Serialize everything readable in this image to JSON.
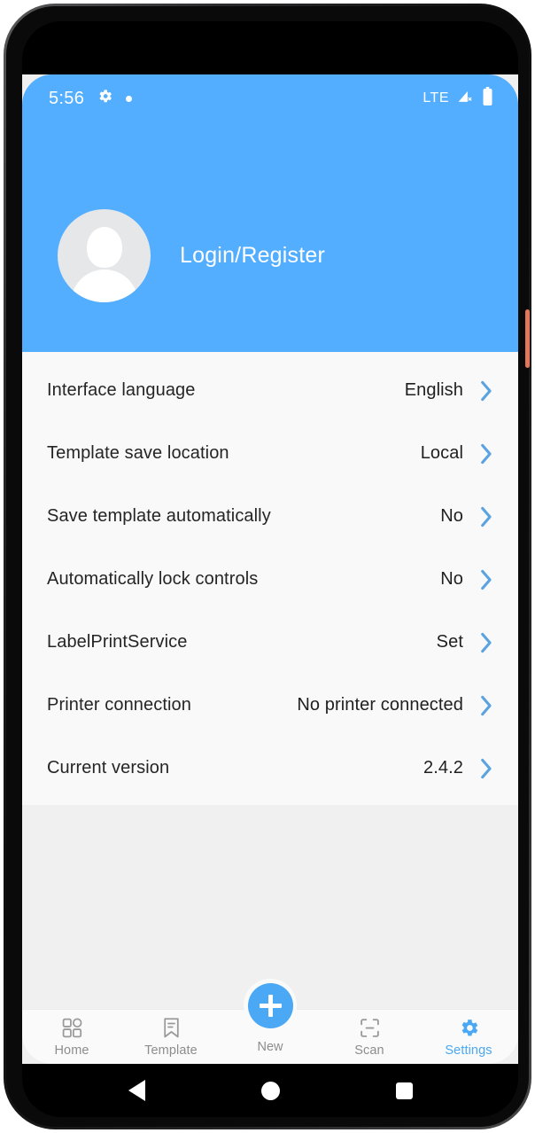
{
  "status_bar": {
    "time": "5:56",
    "gear_icon": "gear-icon",
    "dot_icon": "dot-indicator-icon",
    "network": "LTE",
    "signal_icon": "signal-no-service-icon",
    "battery_icon": "battery-full-icon"
  },
  "header": {
    "avatar_icon": "person-avatar-icon",
    "login_label": "Login/Register",
    "background_color": "#54aeff"
  },
  "settings": {
    "rows": [
      {
        "label": "Interface language",
        "value": "English",
        "chevron": "chevron-right-icon"
      },
      {
        "label": "Template save location",
        "value": "Local",
        "chevron": "chevron-right-icon"
      },
      {
        "label": "Save template automatically",
        "value": "No",
        "chevron": "chevron-right-icon"
      },
      {
        "label": "Automatically lock controls",
        "value": "No",
        "chevron": "chevron-right-icon"
      },
      {
        "label": "LabelPrintService",
        "value": "Set",
        "chevron": "chevron-right-icon"
      },
      {
        "label": "Printer connection",
        "value": "No printer connected",
        "chevron": "chevron-right-icon"
      },
      {
        "label": "Current version",
        "value": "2.4.2",
        "chevron": "chevron-right-icon"
      }
    ]
  },
  "tabbar": {
    "active": "Settings",
    "accent_color": "#4aa8f5",
    "inactive_color": "#8d8d8d",
    "items": [
      {
        "label": "Home",
        "icon": "grid-icon"
      },
      {
        "label": "Template",
        "icon": "bookmark-icon"
      },
      {
        "label": "New",
        "icon": "plus-circle-icon"
      },
      {
        "label": "Scan",
        "icon": "scan-frame-icon"
      },
      {
        "label": "Settings",
        "icon": "gear-icon"
      }
    ]
  },
  "system_nav": {
    "back": "back-triangle-icon",
    "home": "home-circle-icon",
    "recents": "recents-square-icon"
  }
}
